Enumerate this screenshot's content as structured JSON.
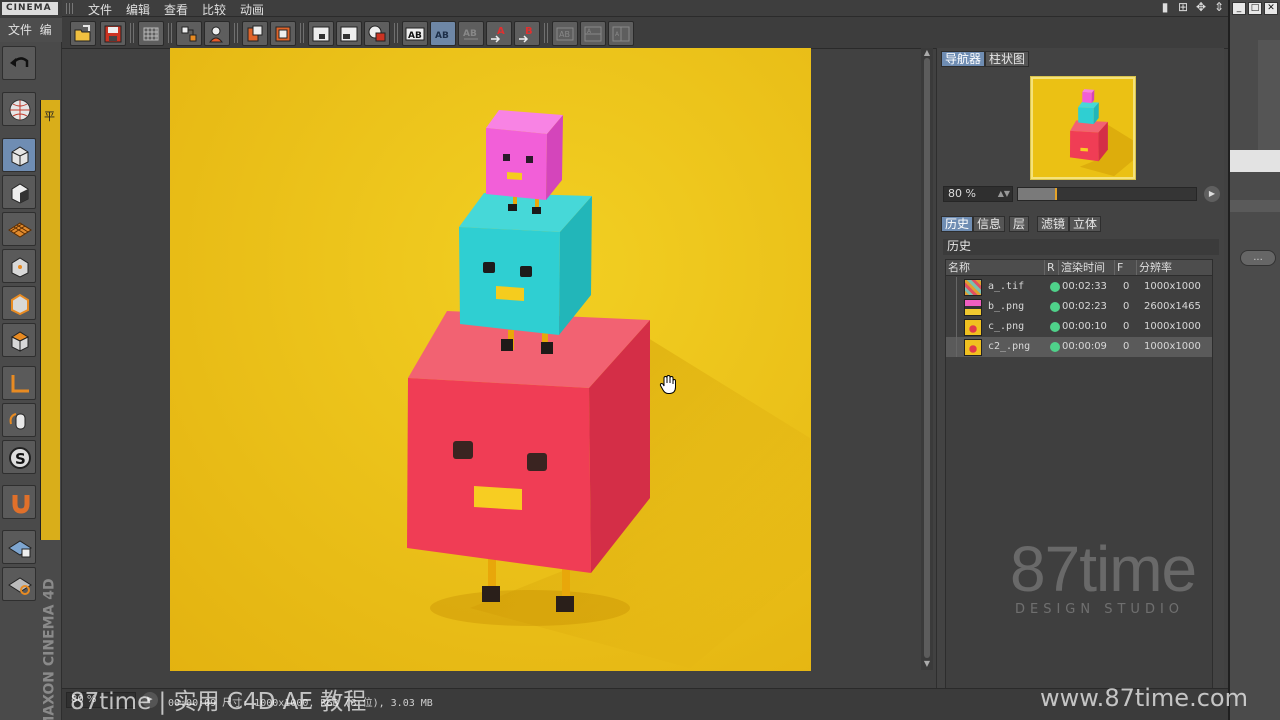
{
  "app": {
    "logo_text": "CINEMA",
    "main_menu": [
      "文件",
      "编"
    ],
    "viewport_label": "平",
    "maxon_text": "MAXON CINEMA 4D",
    "right_dots_button": "..."
  },
  "picture_viewer": {
    "menu": [
      "文件",
      "编辑",
      "查看",
      "比较",
      "动画"
    ],
    "toolbar_icons": [
      "open-icon",
      "save-icon",
      "grid-icon",
      "layers-icon",
      "person-icon",
      "filter-copy-icon",
      "filter-paste-icon",
      "viewport-icon",
      "viewport-alt-icon",
      "eye-icon",
      "ab-icon",
      "ab-active-icon",
      "ab-disabled-icon",
      "set-a-icon",
      "set-b-icon",
      "compare-1-icon",
      "compare-2-icon",
      "compare-3-icon"
    ],
    "navigator": {
      "tabs": [
        "导航器",
        "柱状图"
      ],
      "zoom_value": "80 %",
      "zoom_fraction": 0.22
    },
    "lower_tabs": [
      "历史",
      "信息",
      "层",
      "滤镜",
      "立体"
    ],
    "history": {
      "title": "历史",
      "columns": [
        "名称",
        "R",
        "渲染时间",
        "F",
        "分辨率"
      ],
      "rows": [
        {
          "name": "a_.tif",
          "time": "00:02:33",
          "frame": "0",
          "res": "1000x1000",
          "status_color": "#4fd18a",
          "selected": false
        },
        {
          "name": "b_.png",
          "time": "00:02:23",
          "frame": "0",
          "res": "2600x1465",
          "status_color": "#4fd18a",
          "selected": false
        },
        {
          "name": "c_.png",
          "time": "00:00:10",
          "frame": "0",
          "res": "1000x1000",
          "status_color": "#4fd18a",
          "selected": false
        },
        {
          "name": "c2_.png",
          "time": "00:00:09",
          "frame": "0",
          "res": "1000x1000",
          "status_color": "#4fd18a",
          "selected": true
        }
      ]
    },
    "status": {
      "zoom": "80 %",
      "text": "00:00:09  尺寸: 1000x1000, RGB (8 位), 3.03 MB"
    }
  },
  "watermarks": {
    "brand": "87time",
    "tagline": "DESIGN STUDIO",
    "course": "87time | 实用 C4D AE 教程",
    "url": "www.87time.com"
  },
  "colors": {
    "background_yellow": "#ebc114",
    "cube_red": "#f04a5c",
    "cube_teal": "#2ecfcf",
    "cube_pink": "#f25fd8",
    "active_tab": "#6f8db3"
  }
}
